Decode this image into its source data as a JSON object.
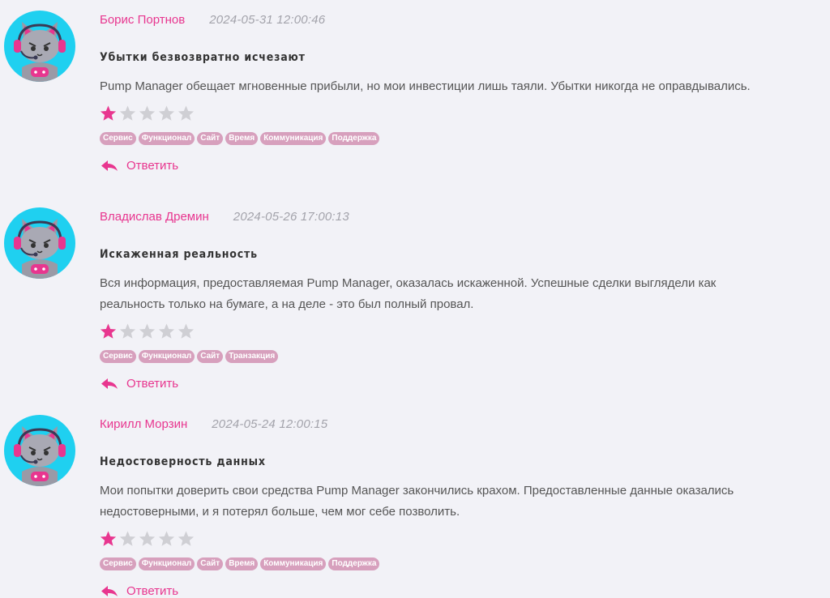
{
  "colors": {
    "accent": "#e8368f",
    "avatar_bg": "#1fd0f0",
    "tag_bg": "#d7a0bd",
    "star_empty": "#cfcfd4"
  },
  "icons": {
    "avatar": "cat-gamer-avatar-icon",
    "star": "star-icon",
    "reply": "reply-arrow-icon"
  },
  "reviews": [
    {
      "author": "Борис Портнов",
      "date": "2024-05-31 12:00:46",
      "title": "Убытки безвозвратно исчезают",
      "lines": [
        "Pump Manager обещает мгновенные прибыли, но мои инвестиции лишь таяли. Убытки никогда не оправдывались."
      ],
      "rating": 1,
      "max_rating": 5,
      "tags": [
        "Сервис",
        "Функционал",
        "Сайт",
        "Время",
        "Коммуникация",
        "Поддержка"
      ],
      "reply_label": "Ответить"
    },
    {
      "author": "Владислав Дремин",
      "date": "2024-05-26 17:00:13",
      "title": "Искаженная реальность",
      "lines": [
        "Вся информация, предоставляемая Pump Manager, оказалась искаженной. Успешные сделки выглядели как",
        "реальность только на бумаге, а на деле - это был полный провал."
      ],
      "rating": 1,
      "max_rating": 5,
      "tags": [
        "Сервис",
        "Функционал",
        "Сайт",
        "Транзакция"
      ],
      "reply_label": "Ответить"
    },
    {
      "author": "Кирилл Морзин",
      "date": "2024-05-24 12:00:15",
      "title": "Недостоверность данных",
      "lines": [
        "Мои попытки доверить свои средства Pump Manager закончились крахом. Предоставленные данные оказались",
        "недостоверными, и я потерял больше, чем мог себе позволить."
      ],
      "rating": 1,
      "max_rating": 5,
      "tags": [
        "Сервис",
        "Функционал",
        "Сайт",
        "Время",
        "Коммуникация",
        "Поддержка"
      ],
      "reply_label": "Ответить"
    }
  ]
}
